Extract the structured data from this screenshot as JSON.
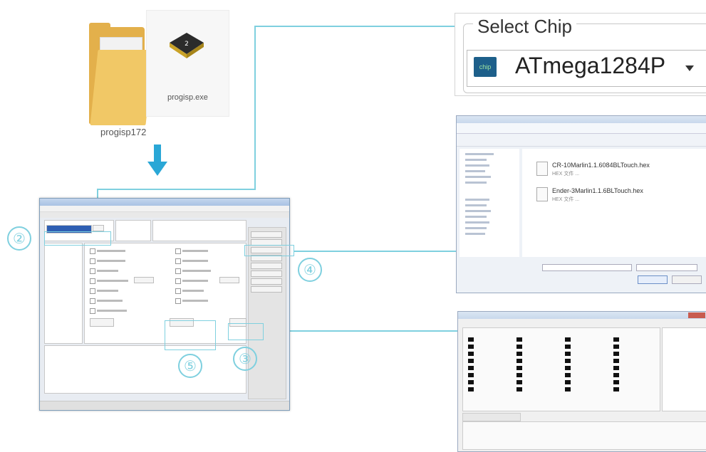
{
  "files": {
    "exe_name": "progisp.exe",
    "folder_name": "progisp172"
  },
  "steps": {
    "step2": "②",
    "step3": "③",
    "step4": "④",
    "step5": "⑤"
  },
  "select_chip": {
    "label": "Select Chip",
    "value": "ATmega1284P",
    "icon_text": "chip"
  },
  "file_dialog": {
    "files": [
      {
        "name": "CR-10Marlin1.1.6084BLTouch.hex",
        "meta": "HEX 文件 ..."
      },
      {
        "name": "Ender-3Marlin1.1.6BLTouch.hex",
        "meta": "HEX 文件 ..."
      }
    ]
  },
  "colors": {
    "accent_line": "#7fd0df",
    "arrow": "#2aa7d6",
    "folder": "#e3b04b"
  },
  "icons": {
    "folder": "folder-icon",
    "chip": "chip-icon",
    "arrow": "arrow-down-icon"
  }
}
